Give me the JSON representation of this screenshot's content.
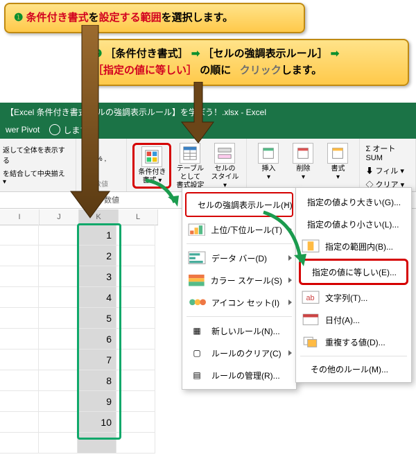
{
  "callouts": {
    "one_num": "❶",
    "one_a": "条件付き書式",
    "one_b": "を",
    "one_c": "設定する範囲",
    "one_d": "を選択します。",
    "two_num": "❷",
    "two_a": "［条件付き書式］",
    "two_b": "［セルの強調表示ルール］",
    "two_c": "［指定の値に等しい］",
    "two_d": "の順に",
    "two_e": "クリック",
    "two_f": "します。",
    "arrow": "➡"
  },
  "titlebar": "【Excel 条件付き書式 セルの強調表示ルール】を学ぼう！.xlsx - Excel",
  "ribbon_tabs": {
    "power_pivot": "wer Pivot",
    "tell_me": "しますか"
  },
  "ribbon": {
    "wrap": "返して全体を表示する",
    "merge": "を結合して中央揃え ▾",
    "pct": "%  ,",
    "dec": "←0 .00  .00 →0",
    "group_num": "数値",
    "cond": "条件付き\n書式 ▾",
    "table": "テーブルとして\n書式設定 ▾",
    "cellstyle": "セルの\nスタイル ▾",
    "insert": "挿入\n▾",
    "delete": "削除\n▾",
    "format": "書式\n▾",
    "autosum": "Σ オート SUM",
    "fill": "⬇ フィル ▾",
    "clear": "◇ クリア ▾"
  },
  "columns": [
    "I",
    "J",
    "K",
    "L"
  ],
  "k_values": [
    "1",
    "2",
    "3",
    "4",
    "5",
    "6",
    "7",
    "8",
    "9",
    "10"
  ],
  "menu1": {
    "highlight": "セルの強調表示ルール(H)",
    "top": "上位/下位ルール(T)",
    "databar": "データ バー(D)",
    "colorscale": "カラー スケール(S)",
    "iconset": "アイコン セット(I)",
    "newrule": "新しいルール(N)...",
    "clear": "ルールのクリア(C)",
    "manage": "ルールの管理(R)..."
  },
  "menu2": {
    "gt": "指定の値より大きい(G)...",
    "lt": "指定の値より小さい(L)...",
    "between": "指定の範囲内(B)...",
    "equal": "指定の値に等しい(E)...",
    "text": "文字列(T)...",
    "date": "日付(A)...",
    "dup": "重複する値(D)...",
    "other": "その他のルール(M)..."
  }
}
